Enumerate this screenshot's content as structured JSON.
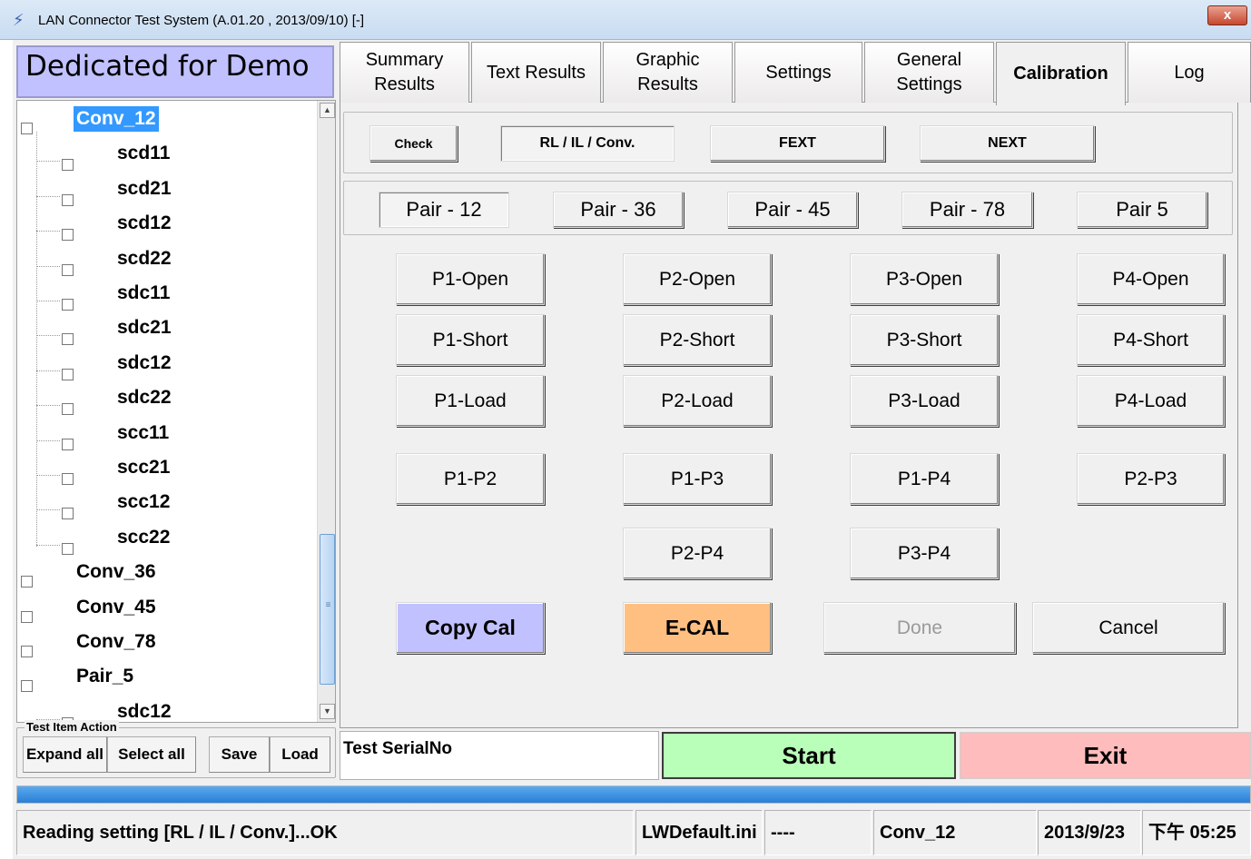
{
  "window": {
    "title": "LAN Connector Test System  (A.01.20 , 2013/09/10)  [-]",
    "close_label": "x"
  },
  "banner": "Dedicated for Demo",
  "tree": {
    "items": [
      {
        "label": "Conv_12",
        "level": 0,
        "selected": true
      },
      {
        "label": "scd11",
        "level": 1
      },
      {
        "label": "scd21",
        "level": 1
      },
      {
        "label": "scd12",
        "level": 1
      },
      {
        "label": "scd22",
        "level": 1
      },
      {
        "label": "sdc11",
        "level": 1
      },
      {
        "label": "sdc21",
        "level": 1
      },
      {
        "label": "sdc12",
        "level": 1
      },
      {
        "label": "sdc22",
        "level": 1
      },
      {
        "label": "scc11",
        "level": 1
      },
      {
        "label": "scc21",
        "level": 1
      },
      {
        "label": "scc12",
        "level": 1
      },
      {
        "label": "scc22",
        "level": 1
      },
      {
        "label": "Conv_36",
        "level": 0
      },
      {
        "label": "Conv_45",
        "level": 0
      },
      {
        "label": "Conv_78",
        "level": 0
      },
      {
        "label": "Pair_5",
        "level": 0
      },
      {
        "label": "sdc12",
        "level": 1
      }
    ],
    "scroll_up_icon": "▲",
    "scroll_down_icon": "▼",
    "scroll_grip": "≡"
  },
  "test_item_action": {
    "legend": "Test Item Action",
    "expand_all": "Expand all",
    "select_all": "Select all",
    "save": "Save",
    "load": "Load"
  },
  "tabs": [
    {
      "label": "Summary\nResults"
    },
    {
      "label": "Text Results"
    },
    {
      "label": "Graphic\nResults"
    },
    {
      "label": "Settings"
    },
    {
      "label": "General\nSettings"
    },
    {
      "label": "Calibration",
      "active": true
    },
    {
      "label": "Log"
    }
  ],
  "calibration": {
    "modes": {
      "check": "Check",
      "rl_il_conv": "RL / IL / Conv.",
      "fext": "FEXT",
      "next": "NEXT"
    },
    "pairs": [
      "Pair - 12",
      "Pair - 36",
      "Pair - 45",
      "Pair - 78",
      "Pair 5"
    ],
    "cal_buttons": [
      [
        "P1-Open",
        "P2-Open",
        "P3-Open",
        "P4-Open"
      ],
      [
        "P1-Short",
        "P2-Short",
        "P3-Short",
        "P4-Short"
      ],
      [
        "P1-Load",
        "P2-Load",
        "P3-Load",
        "P4-Load"
      ],
      [
        "P1-P2",
        "P1-P3",
        "P1-P4",
        "P2-P3"
      ]
    ],
    "extra_buttons": [
      "P2-P4",
      "P3-P4"
    ],
    "copy_cal": "Copy Cal",
    "ecal": "E-CAL",
    "done": "Done",
    "cancel": "Cancel",
    "colors": {
      "copy_cal": "#c1c1ff",
      "ecal": "#ffbf80"
    }
  },
  "bottom": {
    "serial_label": "Test SerialNo",
    "start": "Start",
    "exit": "Exit",
    "colors": {
      "start": "#b9ffb9",
      "exit": "#ffbcbc"
    }
  },
  "progress": {
    "fraction": 1.0,
    "color": "#2a7fd6"
  },
  "status": {
    "message": "Reading setting [RL / IL / Conv.]...OK",
    "file": "LWDefault.ini",
    "field2": "----",
    "item": "Conv_12",
    "date": "2013/9/23",
    "time": "下午 05:25"
  }
}
